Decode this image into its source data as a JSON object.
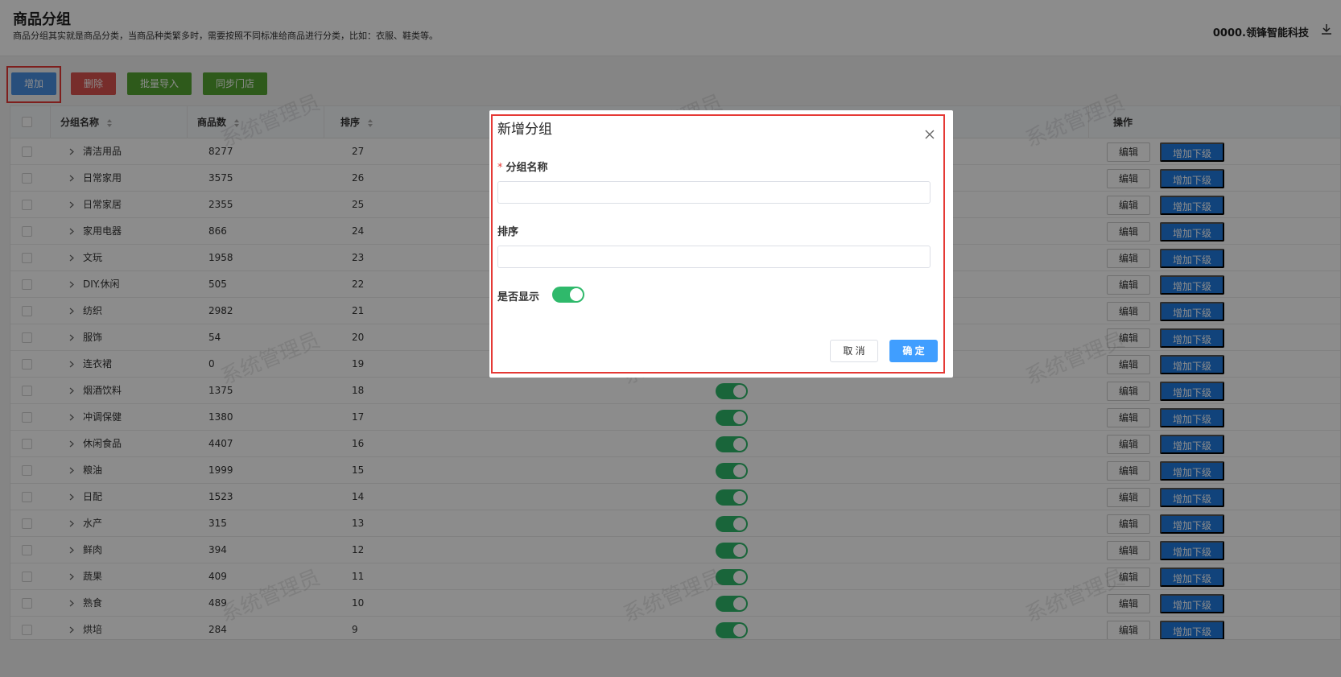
{
  "header": {
    "title": "商品分组",
    "description": "商品分组其实就是商品分类，当商品种类繁多时，需要按照不同标准给商品进行分类，比如：衣服、鞋类等。",
    "company": "0000.领锋智能科技"
  },
  "toolbar": {
    "add_label": "增加",
    "delete_label": "删除",
    "import_label": "批量导入",
    "sync_label": "同步门店"
  },
  "table": {
    "columns": {
      "name": "分组名称",
      "count": "商品数",
      "sort": "排序",
      "actions": "操作"
    },
    "edit_label": "编辑",
    "add_sub_label": "增加下级",
    "rows": [
      {
        "name": "清洁用品",
        "count": "8277",
        "sort": "27"
      },
      {
        "name": "日常家用",
        "count": "3575",
        "sort": "26"
      },
      {
        "name": "日常家居",
        "count": "2355",
        "sort": "25"
      },
      {
        "name": "家用电器",
        "count": "866",
        "sort": "24"
      },
      {
        "name": "文玩",
        "count": "1958",
        "sort": "23"
      },
      {
        "name": "DIY.休闲",
        "count": "505",
        "sort": "22"
      },
      {
        "name": "纺织",
        "count": "2982",
        "sort": "21"
      },
      {
        "name": "服饰",
        "count": "54",
        "sort": "20"
      },
      {
        "name": "连衣裙",
        "count": "0",
        "sort": "19"
      },
      {
        "name": "烟酒饮料",
        "count": "1375",
        "sort": "18"
      },
      {
        "name": "冲调保健",
        "count": "1380",
        "sort": "17"
      },
      {
        "name": "休闲食品",
        "count": "4407",
        "sort": "16"
      },
      {
        "name": "粮油",
        "count": "1999",
        "sort": "15"
      },
      {
        "name": "日配",
        "count": "1523",
        "sort": "14"
      },
      {
        "name": "水产",
        "count": "315",
        "sort": "13"
      },
      {
        "name": "鲜肉",
        "count": "394",
        "sort": "12"
      },
      {
        "name": "蔬果",
        "count": "409",
        "sort": "11"
      },
      {
        "name": "熟食",
        "count": "489",
        "sort": "10"
      },
      {
        "name": "烘培",
        "count": "284",
        "sort": "9"
      }
    ]
  },
  "watermark": "系统管理员",
  "modal": {
    "title": "新增分组",
    "name_label": "分组名称",
    "required_mark": "*",
    "name_value": "",
    "sort_label": "排序",
    "sort_value": "",
    "show_label": "是否显示",
    "show_enabled": true,
    "cancel_label": "取 消",
    "ok_label": "确 定"
  },
  "colors": {
    "primary": "#4a90e2",
    "danger": "#d9534f",
    "success": "#55a532",
    "switch_on": "#2fb96b",
    "ok_button": "#409eff",
    "highlight": "#e53935"
  }
}
